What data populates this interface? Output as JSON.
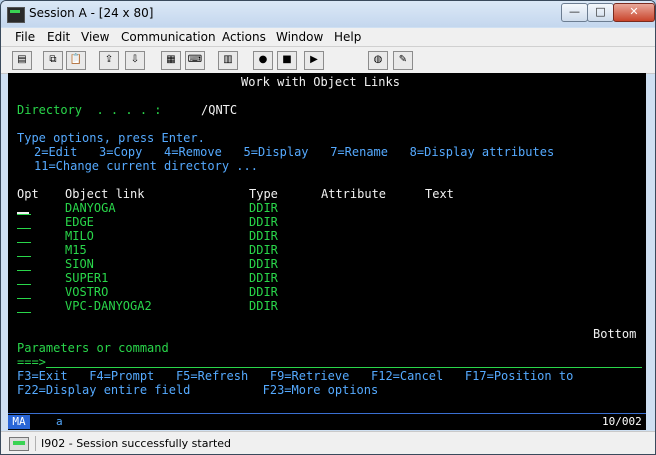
{
  "window": {
    "title": "Session A - [24 x 80]"
  },
  "menu": [
    "File",
    "Edit",
    "View",
    "Communication",
    "Actions",
    "Window",
    "Help"
  ],
  "toolbar_icons": [
    "print-screen-icon",
    "copy-icon",
    "paste-icon",
    "send-icon",
    "receive-icon",
    "display-icon",
    "keyboard-icon",
    "macro-icon",
    "record-macro-icon",
    "stop-macro-icon",
    "play-macro-icon",
    "globe-icon",
    "edit-icon"
  ],
  "screen": {
    "title": "Work with Object Links",
    "directory_label": "Directory  . . . . :",
    "directory_value": "/QNTC",
    "options_heading": "Type options, press Enter.",
    "options_line1": "2=Edit   3=Copy   4=Remove   5=Display   7=Rename   8=Display attributes",
    "options_line2": "11=Change current directory ...",
    "columns": {
      "opt": "Opt",
      "object": "Object link",
      "type": "Type",
      "attribute": "Attribute",
      "text": "Text"
    },
    "rows": [
      {
        "name": "DANYOGA",
        "type": "DDIR"
      },
      {
        "name": "EDGE",
        "type": "DDIR"
      },
      {
        "name": "MILO",
        "type": "DDIR"
      },
      {
        "name": "M15",
        "type": "DDIR"
      },
      {
        "name": "SION",
        "type": "DDIR"
      },
      {
        "name": "SUPER1",
        "type": "DDIR"
      },
      {
        "name": "VOSTRO",
        "type": "DDIR"
      },
      {
        "name": "VPC-DANYOGA2",
        "type": "DDIR"
      }
    ],
    "bottom": "Bottom",
    "params_label": "Parameters or command",
    "prompt": "===>",
    "fkeys1": "F3=Exit   F4=Prompt   F5=Refresh   F9=Retrieve   F12=Cancel   F17=Position to",
    "fkeys2": "F22=Display entire field          F23=More options"
  },
  "oia": {
    "indicator": "MA",
    "mode": "a",
    "position": "10/002"
  },
  "status": {
    "message": "I902 - Session successfully started"
  }
}
